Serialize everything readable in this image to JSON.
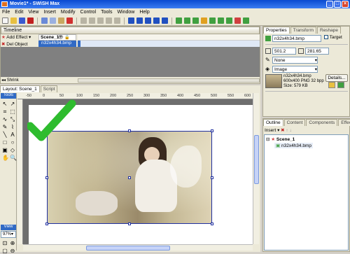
{
  "window": {
    "title": "Movie1* - SWiSH Max"
  },
  "menu": [
    "File",
    "Edit",
    "View",
    "Insert",
    "Modify",
    "Control",
    "Tools",
    "Window",
    "Help"
  ],
  "timeline": {
    "header": "Timeline",
    "add_effect": "Add Effect",
    "del_object": "Del Object",
    "scene_row": "Scene_1",
    "object_row": "n32x4h34.bmp",
    "shrink": "Shrink"
  },
  "layout": {
    "tab_layout": "Layout: Scene_1",
    "tab_script": "Script",
    "zoom": "97%",
    "view_label": "View",
    "toolbox_label": "Tools",
    "ruler_ticks": [
      "-50",
      "0",
      "50",
      "100",
      "150",
      "200",
      "250",
      "300",
      "350",
      "400",
      "450",
      "500",
      "550",
      "600"
    ]
  },
  "properties": {
    "tabs": [
      "Properties",
      "Transform",
      "Reshape"
    ],
    "name_value": "n32x4h34.bmp",
    "target_label": "Target",
    "width_value": "501.2",
    "height_value": "281.65",
    "line_select": "None",
    "fill_select": "Image",
    "image_name": "n32x4h34.bmp",
    "image_info": "600x400 PNG 32 bpp",
    "image_size": "Size: 579 KB",
    "details_button": "Details..."
  },
  "outline": {
    "tabs": [
      "Outline",
      "Content",
      "Components",
      "Effect"
    ],
    "insert_label": "Insert",
    "tree": [
      "Scene_1",
      "n32x4h34.bmp"
    ]
  },
  "colors": {
    "title_start": "#0a4ad0",
    "title_end": "#3b7cf2",
    "checkmark": "#2ebc2e",
    "selection": "#2030a0"
  }
}
